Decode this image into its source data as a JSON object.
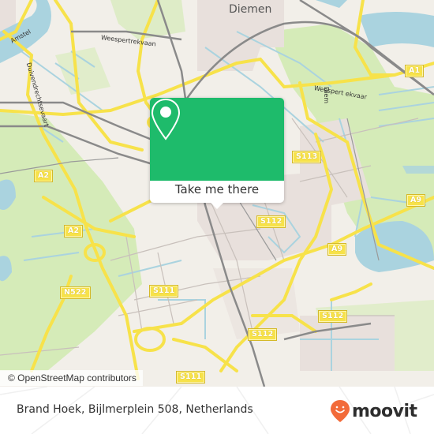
{
  "map": {
    "place_labels": [
      {
        "id": "diemen",
        "text": "Diemen"
      }
    ],
    "street_labels": [
      {
        "id": "weespertrekvaan",
        "text": "Weespertrekvaan"
      },
      {
        "id": "amstel",
        "text": "Amstel"
      },
      {
        "id": "duivendrechtsevaart",
        "text": "Duivendrechtsevaart"
      },
      {
        "id": "diem",
        "text": "Diem"
      },
      {
        "id": "gaasperdreef",
        "text": "Weespert ekvaar"
      }
    ],
    "road_shields": [
      {
        "id": "a1",
        "text": "A1"
      },
      {
        "id": "a2-north",
        "text": "A2"
      },
      {
        "id": "a2-south",
        "text": "A2"
      },
      {
        "id": "a9-east",
        "text": "A9"
      },
      {
        "id": "a9-mid",
        "text": "A9"
      },
      {
        "id": "s113",
        "text": "S113"
      },
      {
        "id": "s112-north",
        "text": "S112"
      },
      {
        "id": "s112-east",
        "text": "S112"
      },
      {
        "id": "s112-south",
        "text": "S112"
      },
      {
        "id": "s111-mid",
        "text": "S111"
      },
      {
        "id": "s111-bottom",
        "text": "S111"
      },
      {
        "id": "n522",
        "text": "N522"
      }
    ],
    "attribution": "© OpenStreetMap contributors",
    "colors": {
      "land": "#f2efe9",
      "park": "#d5ebb8",
      "water": "#aad3df",
      "road_major": "#f7e24a",
      "rail": "#8a8a8a",
      "urban": "#e8e0dc"
    }
  },
  "popup": {
    "button_label": "Take me there",
    "pin_icon": "map-pin-icon",
    "color": "#1ebb6b"
  },
  "footer": {
    "address": "Brand Hoek, Bijlmerplein 508, Netherlands",
    "logo_text": "moovit",
    "logo_color": "#f26b3a"
  }
}
